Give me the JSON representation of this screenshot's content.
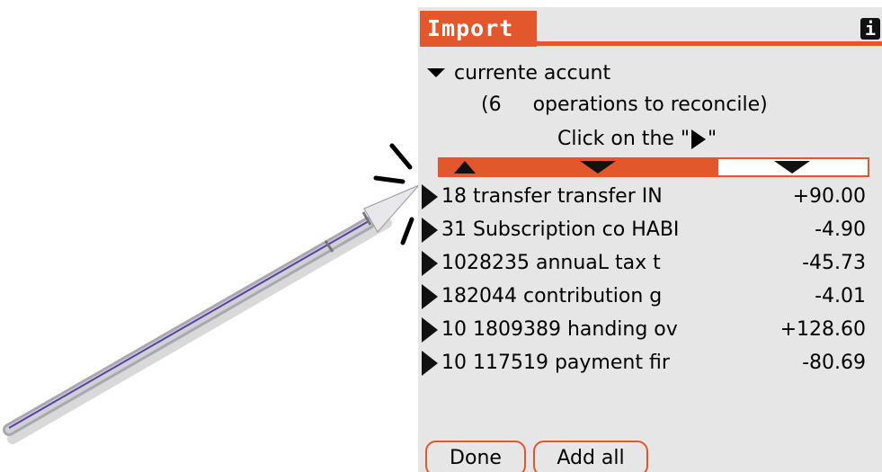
{
  "window": {
    "title": "Import",
    "info_icon": "i"
  },
  "account": {
    "name": "currente accunt"
  },
  "summary": {
    "count_text": "(6",
    "suffix_text": "operations to reconcile)"
  },
  "hint": {
    "prefix": "Click on the \"",
    "suffix": "\""
  },
  "operations": [
    {
      "desc": "18 transfer transfer IN",
      "amount": "+90.00"
    },
    {
      "desc": "31 Subscription co HABI",
      "amount": "-4.90"
    },
    {
      "desc": "1028235 annuaL tax t",
      "amount": "-45.73"
    },
    {
      "desc": "182044 contribution g",
      "amount": "-4.01"
    },
    {
      "desc": "10 1809389 handing ov",
      "amount": "+128.60"
    },
    {
      "desc": "10 117519 payment fir",
      "amount": "-80.69"
    }
  ],
  "buttons": {
    "done": "Done",
    "add_all": "Add all"
  },
  "colors": {
    "accent": "#e2582c",
    "background": "#e6e6e6"
  },
  "icons": [
    "stylus-icon",
    "info-icon",
    "triangle-down-icon",
    "triangle-right-icon",
    "sort-up-icon",
    "sort-down-icon"
  ]
}
